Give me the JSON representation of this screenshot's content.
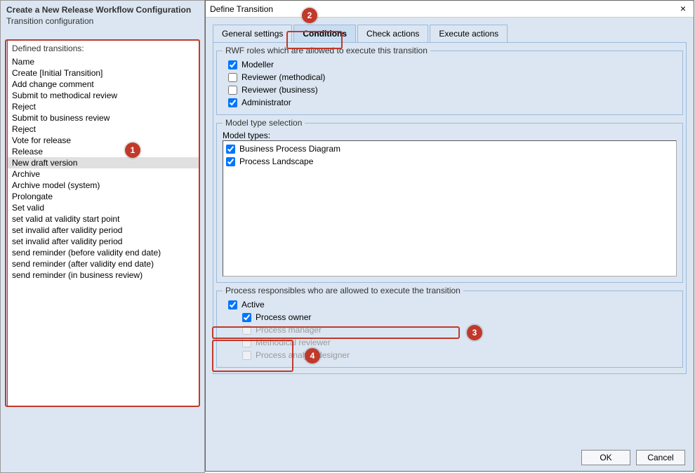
{
  "left": {
    "title": "Create a New Release Workflow Configuration",
    "subtitle": "Transition configuration",
    "list_title": "Defined transitions:",
    "items": [
      "Name",
      "Create [Initial Transition]",
      "Add change comment",
      "Submit to methodical review",
      "Reject",
      "Submit to business review",
      "Reject",
      "Vote for release",
      "Release",
      "New draft version",
      "Archive",
      "Archive model (system)",
      "Prolongate",
      "Set valid",
      "set valid at validity start point",
      "set invalid after validity period",
      "set invalid after validity period",
      "send reminder (before validity end date)",
      "send reminder (after validity end date)",
      "send reminder (in business review)"
    ],
    "selected_index": 9
  },
  "dialog": {
    "title": "Define Transition",
    "tabs": [
      "General settings",
      "Conditions",
      "Check actions",
      "Execute actions"
    ],
    "active_tab": 1,
    "roles_legend": "RWF roles which are allowed to execute this transition",
    "roles": [
      {
        "label": "Modeller",
        "checked": true
      },
      {
        "label": "Reviewer (methodical)",
        "checked": false
      },
      {
        "label": "Reviewer (business)",
        "checked": false
      },
      {
        "label": "Administrator",
        "checked": true
      }
    ],
    "model_legend": "Model type selection",
    "model_label": "Model types:",
    "model_types": [
      {
        "label": "Business Process Diagram",
        "checked": true
      },
      {
        "label": "Process Landscape",
        "checked": true
      }
    ],
    "resp_legend": "Process responsibles who are allowed to execute the transition",
    "resp_active": {
      "label": "Active",
      "checked": true
    },
    "resp_roles": [
      {
        "label": "Process owner",
        "checked": true,
        "disabled": false
      },
      {
        "label": "Process manager",
        "checked": false,
        "disabled": true
      },
      {
        "label": "Methodical reviewer",
        "checked": false,
        "disabled": true
      },
      {
        "label": "Process analyst/designer",
        "checked": false,
        "disabled": true
      }
    ],
    "ok": "OK",
    "cancel": "Cancel"
  },
  "markers": [
    "1",
    "2",
    "3",
    "4"
  ]
}
